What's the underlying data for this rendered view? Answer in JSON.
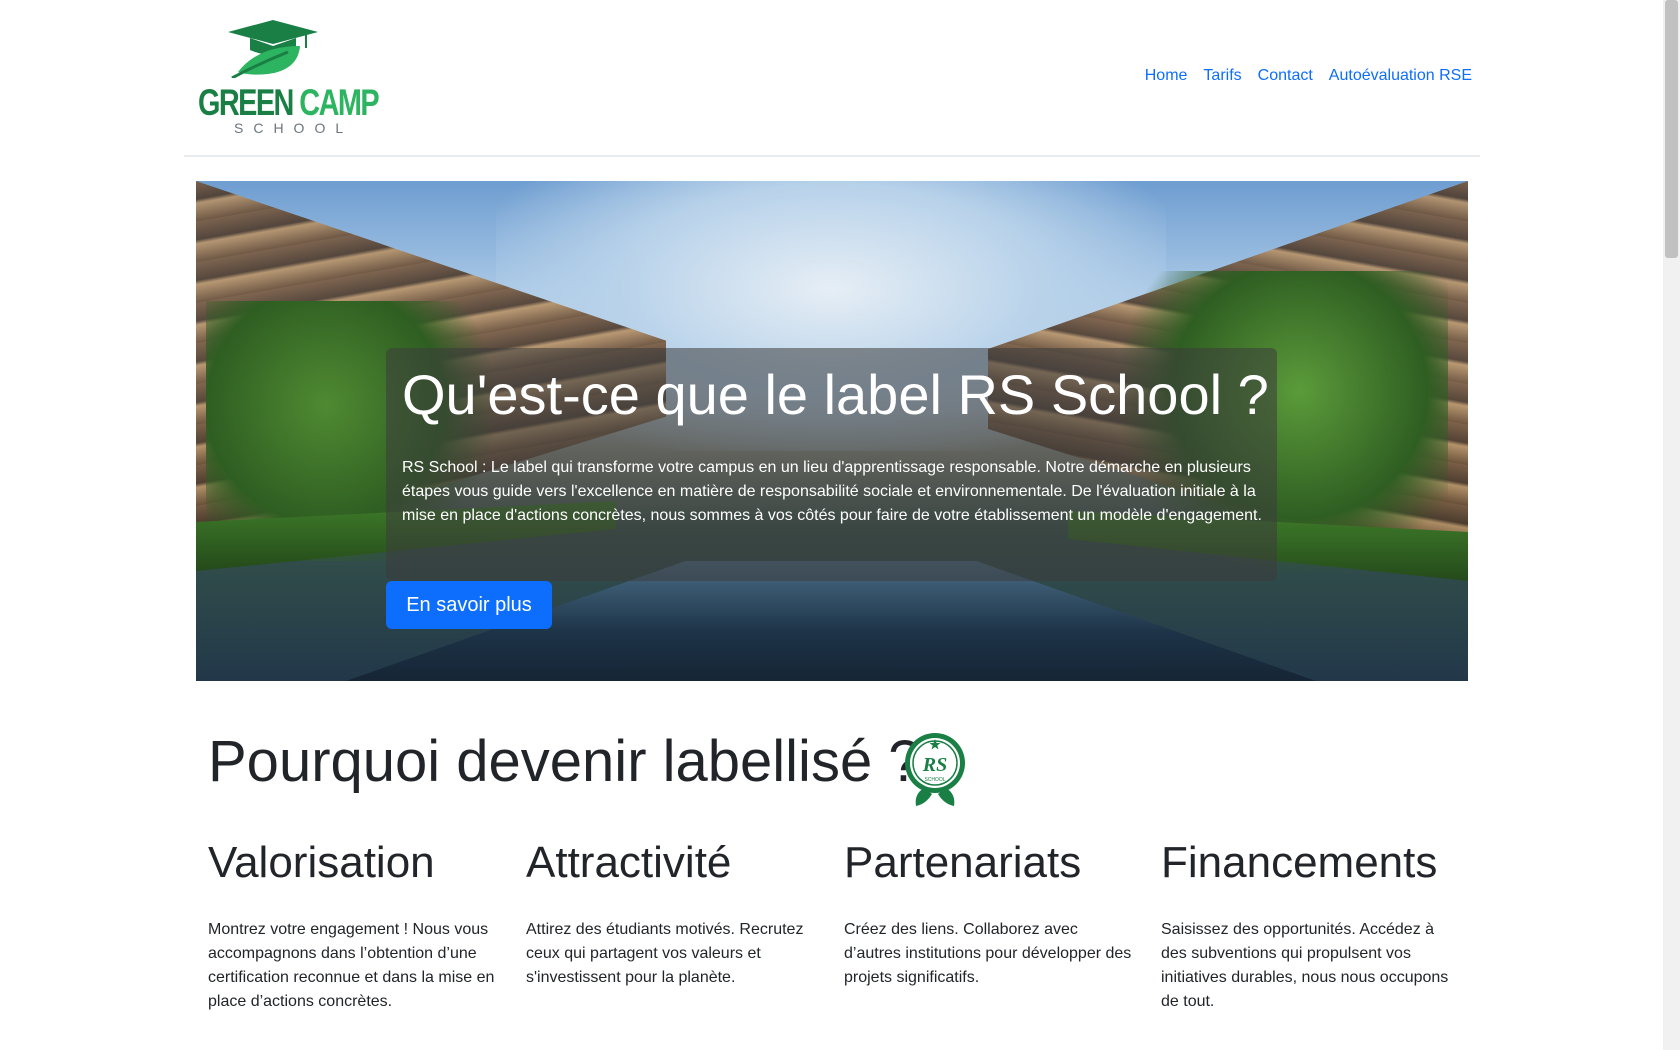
{
  "header": {
    "logo": {
      "word1": "GREEN",
      "word2": "CAMP",
      "sub": "SCHOOL"
    },
    "nav": [
      {
        "label": "Home"
      },
      {
        "label": "Tarifs"
      },
      {
        "label": "Contact"
      },
      {
        "label": "Autoévaluation RSE"
      }
    ]
  },
  "hero": {
    "title": "Qu'est-ce que le label RS School ?",
    "text": "RS School : Le label qui transforme votre campus en un lieu d'apprentissage responsable. Notre démarche en plusieurs étapes vous guide vers l'excellence en matière de responsabilité sociale et environnementale. De l'évaluation initiale à la mise en place d'actions concrètes, nous sommes à vos côtés pour faire de votre établissement un modèle d'engagement.",
    "button": "En savoir plus"
  },
  "why": {
    "title": "Pourquoi devenir labellisé ?",
    "badge": {
      "text": "RS",
      "sub": "SCHOOL"
    },
    "features": [
      {
        "title": "Valorisation",
        "text": "Montrez votre engagement ! Nous vous accompagnons dans l’obtention d’une certification reconnue et dans la mise en place d’actions concrètes."
      },
      {
        "title": "Attractivité",
        "text": "Attirez des étudiants motivés. Recrutez ceux qui partagent vos valeurs et s'investissent pour la planète."
      },
      {
        "title": "Partenariats",
        "text": "Créez des liens. Collaborez avec d’autres institutions pour développer des projets significatifs."
      },
      {
        "title": "Financements",
        "text": "Saisissez des opportunités. Accédez à des subventions qui propulsent vos initiatives durables, nous nous occupons de tout."
      }
    ]
  },
  "colors": {
    "brand_green": "#1a7f45",
    "link_blue": "#0d6efd"
  }
}
